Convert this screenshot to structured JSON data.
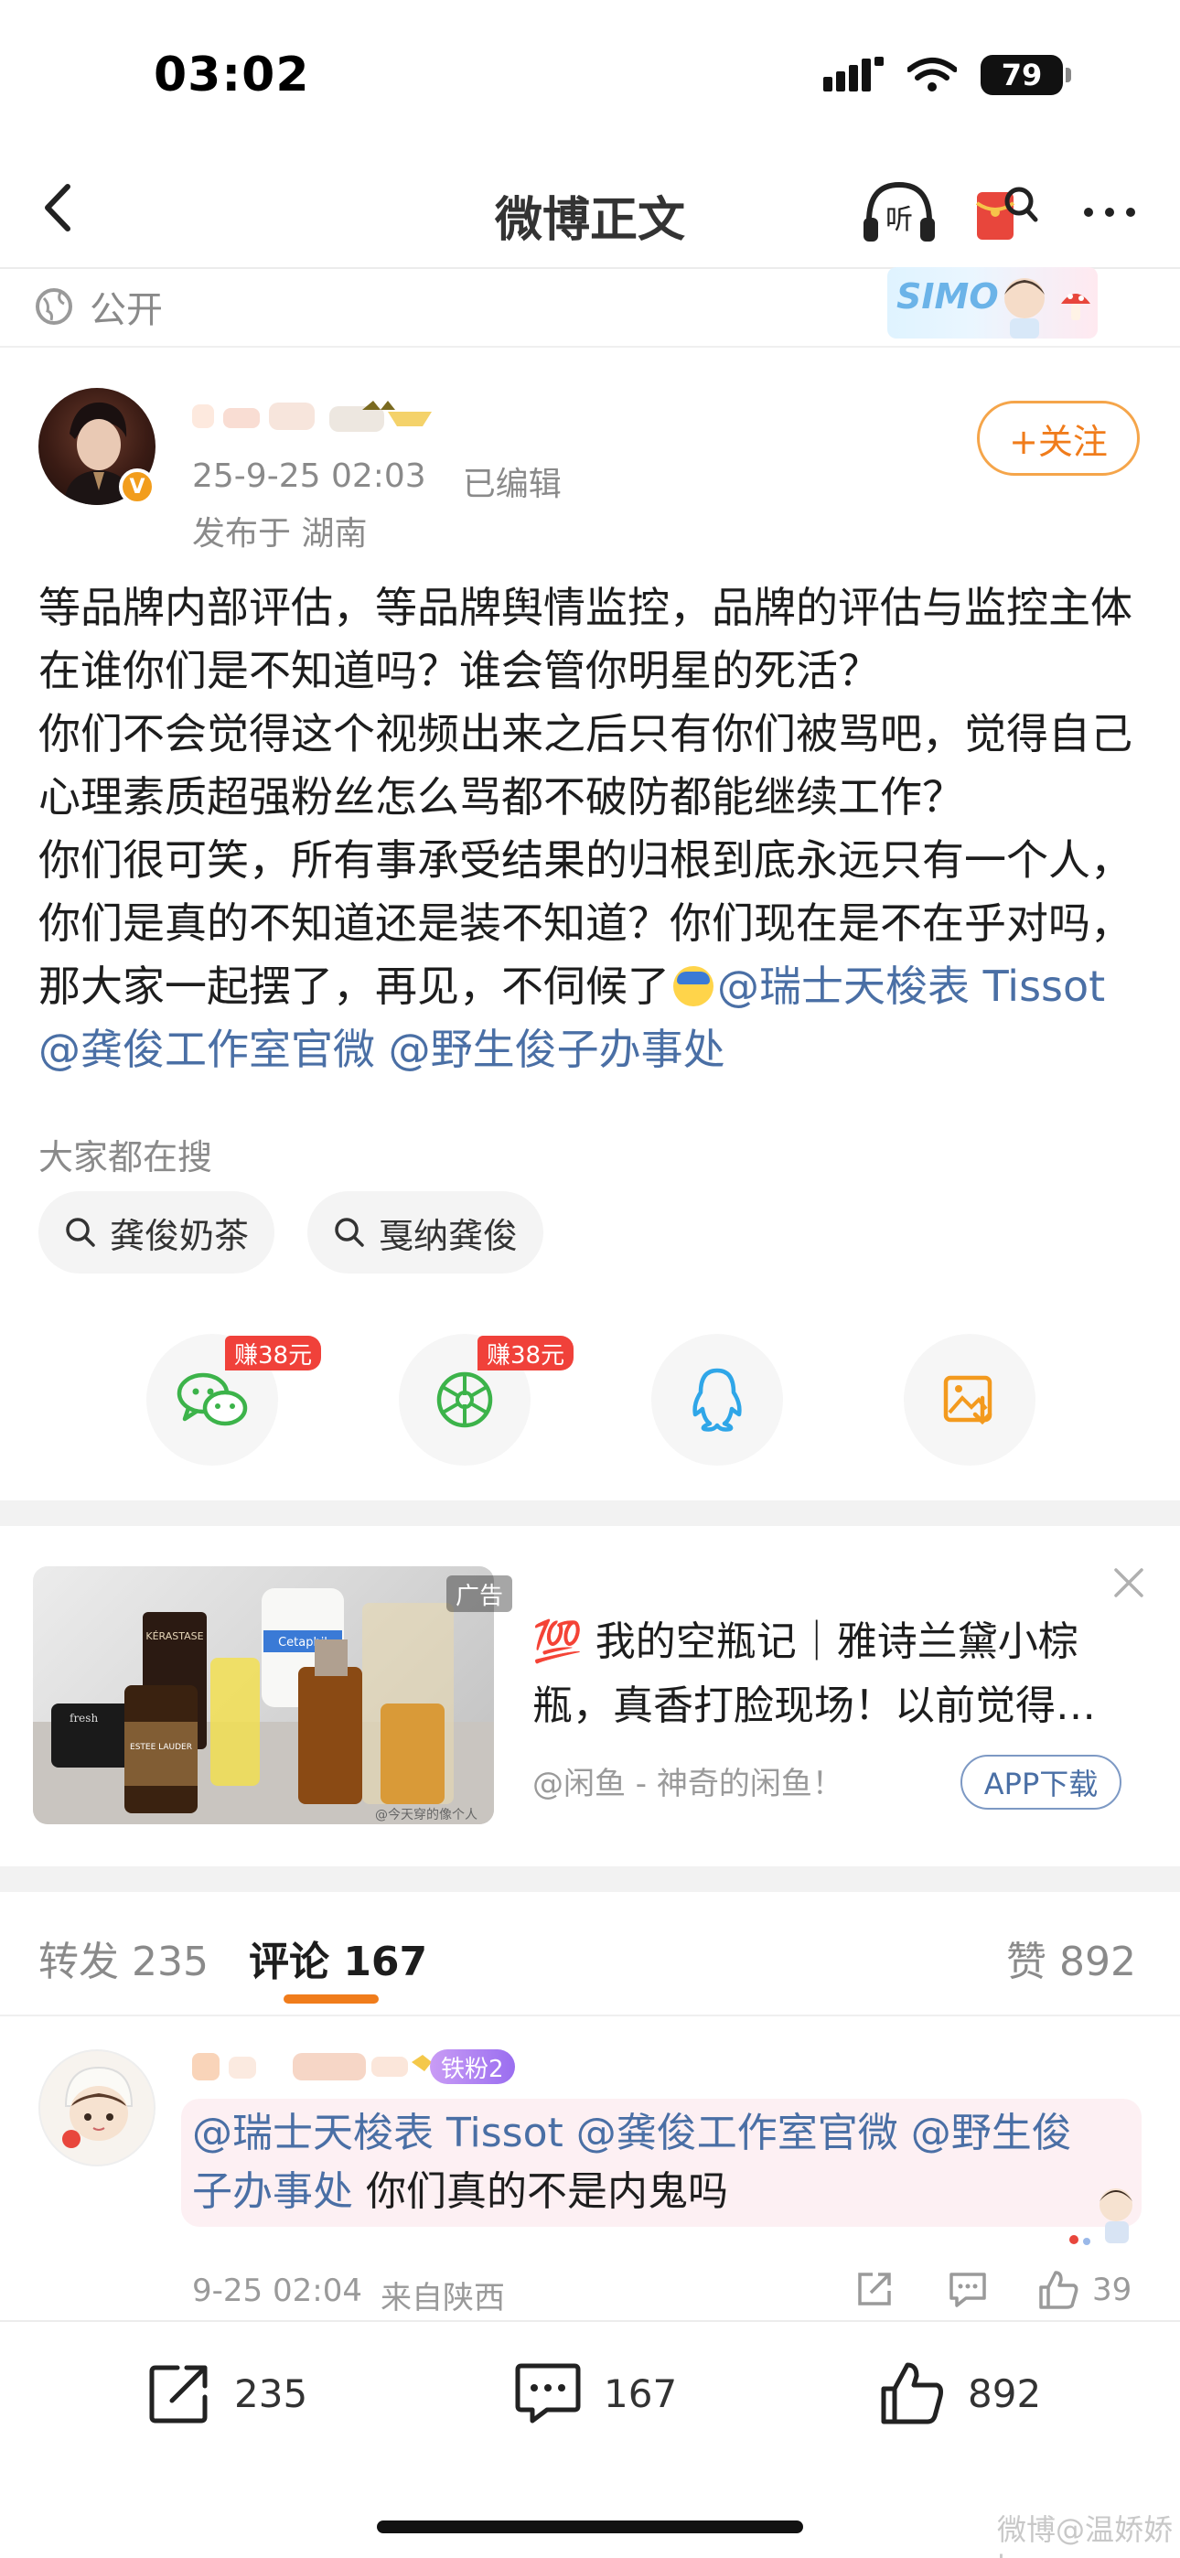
{
  "status_bar": {
    "time": "03:02",
    "battery": "79"
  },
  "nav": {
    "title": "微博正文",
    "listen_label": "听"
  },
  "visibility": {
    "label": "公开"
  },
  "banner": {
    "text": "SIMO"
  },
  "author": {
    "verified_mark": "V",
    "date": "25-9-25 02:03",
    "edited": "已编辑",
    "location": "发布于 湖南",
    "follow_label": "+关注"
  },
  "post": {
    "paragraphs": [
      "等品牌内部评估，等品牌舆情监控，品牌的评估与监控主体在谁你们是不知道吗？谁会管你明星的死活？",
      "你们不会觉得这个视频出来之后只有你们被骂吧，觉得自己心理素质超强粉丝怎么骂都不破防都能继续工作？",
      "你们很可笑，所有事承受结果的归根到底永远只有一个人，你们是真的不知道还是装不知道？你们现在是不在乎对吗，那大家一起摆了，再见，不伺候了"
    ],
    "mentions": [
      "@瑞士天梭表 Tissot",
      "@龚俊工作室官微",
      "@野生俊子办事处"
    ]
  },
  "search": {
    "title": "大家都在搜",
    "pills": [
      "龚俊奶茶",
      "戛纳龚俊"
    ]
  },
  "share": {
    "earn_badge": "赚38元"
  },
  "ad": {
    "tag": "广告",
    "title_emoji": "💯",
    "title": "我的空瓶记｜雅诗兰黛小棕瓶，真香打脸现场！以前觉得…",
    "source": "@闲鱼 - 神奇的闲鱼！",
    "app_button": "APP下载",
    "image_brands": [
      "KÉRASTASE",
      "ESTEE LAUDER",
      "Cetaphil",
      "fresh"
    ],
    "image_watermark": "@今天穿的像个人"
  },
  "tabs": {
    "repost": "转发 235",
    "comments": "评论 167",
    "likes": "赞 892"
  },
  "comment": {
    "fan_badge": "铁粉2",
    "mentions": [
      "@瑞士天梭表 Tissot",
      "@龚俊工作室官微",
      "@野生俊"
    ],
    "mention_tail": "子办事处",
    "text": " 你们真的不是内鬼吗",
    "time": "9-25 02:04",
    "location": "来自陕西",
    "like_count": "39"
  },
  "bottom_bar": {
    "repost_count": "235",
    "comment_count": "167",
    "like_count": "892"
  },
  "watermark": "微博@温娇娇l",
  "colors": {
    "accent": "#f07c1b",
    "mention": "#4a6fa5",
    "badge_red": "#f0413a"
  }
}
